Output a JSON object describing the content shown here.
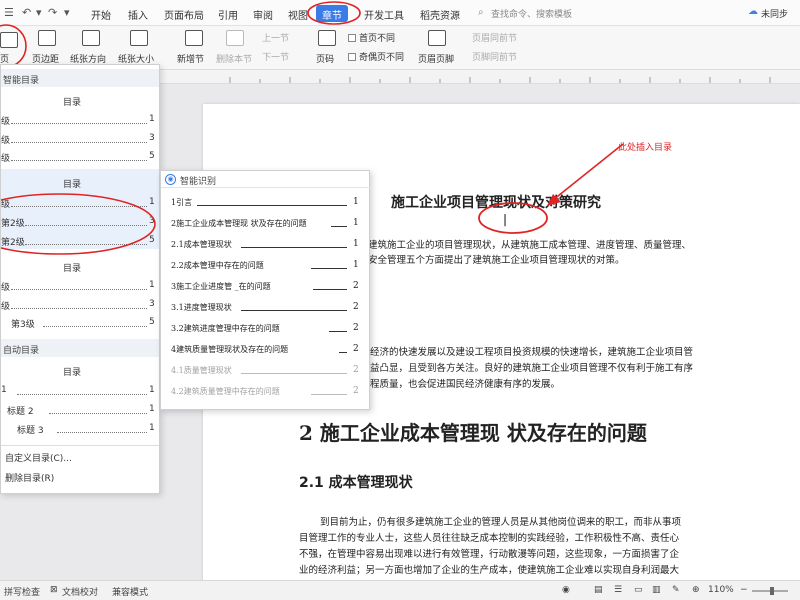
{
  "menubar": {
    "menus": [
      "开始",
      "插入",
      "页面布局",
      "引用",
      "审阅",
      "视图",
      "章节",
      "开发工具",
      "稻壳资源"
    ],
    "active_menu": "章节",
    "search_placeholder": "查找命令、搜索模板",
    "sync_status": "未同步"
  },
  "ribbon": {
    "cover_label": "页",
    "margin_label": "页边距",
    "orientation_label": "纸张方向",
    "size_label": "纸张大小",
    "new_section": "新增节",
    "delete_section": "删除本节",
    "prev_section": "上一节",
    "next_section": "下一节",
    "page_number": "页码",
    "first_page_diff": "首页不同",
    "odd_even_diff": "奇偶页不同",
    "header_footer": "页眉页脚",
    "link_prev_header": "页眉同前节",
    "link_prev_footer": "页脚同前节"
  },
  "toc_panel": {
    "smart_toc_header": "智能目录",
    "auto_toc_header": "自动目录",
    "block_title": "目录",
    "block1": [
      {
        "label": "级",
        "num": "1"
      },
      {
        "label": "级",
        "num": "3"
      },
      {
        "label": "级",
        "num": "5"
      }
    ],
    "block2": [
      {
        "label": "级",
        "num": "1"
      },
      {
        "label": "第2级",
        "num": "3"
      },
      {
        "label": "第2级",
        "num": "5"
      }
    ],
    "block3": [
      {
        "label": "级",
        "num": "1"
      },
      {
        "label": "级",
        "num": "3"
      },
      {
        "label": "第3级",
        "num": "5"
      }
    ],
    "auto_block": [
      {
        "label": " 1",
        "num": "1"
      },
      {
        "label": "标题 2",
        "num": "1"
      },
      {
        "label": "标题 3",
        "num": "1"
      }
    ],
    "custom_toc": "自定义目录(C)...",
    "delete_toc": "删除目录(R)"
  },
  "smart_panel": {
    "header": "智能识别",
    "entries": [
      {
        "text": "1引言",
        "num": "1",
        "dim": false
      },
      {
        "text": "2施工企业成本管理现 状及存在的问题",
        "num": "1",
        "dim": false
      },
      {
        "text": "2.1成本管理现状",
        "num": "1",
        "dim": false
      },
      {
        "text": "2.2成本管理中存在的问题",
        "num": "1",
        "dim": false
      },
      {
        "text": "3施工企业进度管 _在的问题",
        "num": "2",
        "dim": false
      },
      {
        "text": "3.1进度管理现状",
        "num": "2",
        "dim": false
      },
      {
        "text": "3.2建筑进度管理中存在的问题",
        "num": "2",
        "dim": false
      },
      {
        "text": "4建筑质量管理现状及存在的问题",
        "num": "2",
        "dim": false
      },
      {
        "text": "4.1质量管理现状",
        "num": "2",
        "dim": true
      },
      {
        "text": "4.2建筑质量管理中存在的问题",
        "num": "2",
        "dim": true
      }
    ]
  },
  "annotation": {
    "note": "此处插入目录"
  },
  "document": {
    "title": "施工企业项目管理现状及对策研究",
    "abstract1": "建筑施工企业的项目管理现状，从建筑施工成本管理、进度管理、质量管理、",
    "abstract2": "安全管理五个方面提出了建筑施工企业项目管理现状的对策。",
    "intro1": "经济的快速发展以及建设工程项目投资规模的快速增长，建筑施工企业项目管",
    "intro2": "益凸显，且受到各方关注。良好的建筑施工企业项目管理不仅有利于施工有序",
    "intro3": "程质量，也会促进国民经济健康有序的发展。",
    "heading2": "2 施工企业成本管理现   状及存在的问题",
    "heading21": "2.1 成本管理现状",
    "body1": "到目前为止，仍有很多建筑施工企业的管理人员是从其他岗位调来的职工，而非从事项",
    "body2": "目管理工作的专业人士，这些人员往往缺乏成本控制的实践经验，工作积极性不高、责任心",
    "body3": "不强，在管理中容易出现难以进行有效管理，行动散漫等问题，这些现象，一方面损害了企",
    "body4": "业的经济利益；另一方面也增加了企业的生产成本，使建筑施工企业难以实现自身利润最大"
  },
  "statusbar": {
    "spell_check": "拼写检查",
    "doc_proof": "文档校对",
    "compat_mode": "兼容模式",
    "zoom": "110%"
  },
  "colors": {
    "accent": "#3b7be8",
    "annotation_red": "#e02424"
  }
}
